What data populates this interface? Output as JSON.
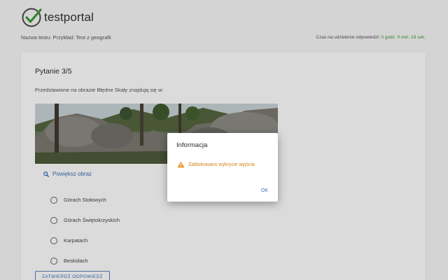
{
  "brand": {
    "name": "testportal"
  },
  "header": {
    "test_name_label": "Nazwa testu:",
    "test_name_value": "Przykład: Test z geografii",
    "timer_label": "Czas na udzielenie odpowiedzi:",
    "timer_value": "0 godz. 0 min. 19 sek."
  },
  "question": {
    "title": "Pytanie 3/5",
    "text": "Przedstawione na obrazie Błędne Skały znajdują się w:",
    "zoom_label": "Powiększ obraz",
    "answers": [
      "Górach Stołowych",
      "Górach Świętokrzyskich",
      "Karpatach",
      "Beskidach"
    ],
    "confirm_label": "ZATWIERDŹ ODPOWIEDŹ"
  },
  "dialog": {
    "title": "Informacja",
    "message": "Zablokowano wykrycie wyjścia",
    "ok_label": "OK"
  },
  "colors": {
    "brand_green": "#3c9d35",
    "link_blue": "#3b6fb6",
    "warning_orange": "#d3811a"
  }
}
